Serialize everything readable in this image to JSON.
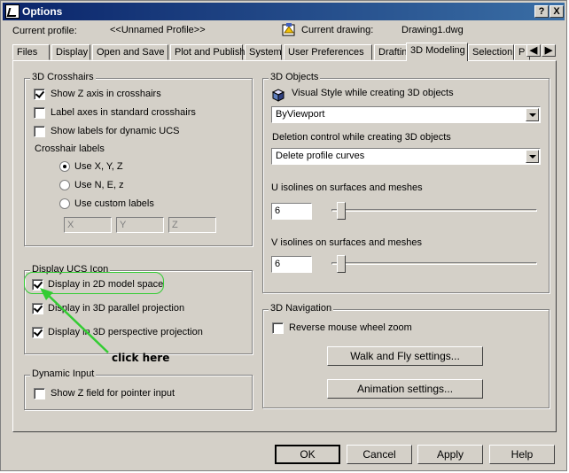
{
  "window": {
    "title": "Options"
  },
  "profile": {
    "label": "Current profile:",
    "value": "<<Unnamed Profile>>"
  },
  "drawing": {
    "label": "Current drawing:",
    "value": "Drawing1.dwg"
  },
  "tabs": [
    "Files",
    "Display",
    "Open and Save",
    "Plot and Publish",
    "System",
    "User Preferences",
    "Drafting",
    "3D Modeling",
    "Selection",
    "P"
  ],
  "active_tab": "3D Modeling",
  "crosshairs": {
    "title": "3D Crosshairs",
    "show_z_axis": "Show Z axis in crosshairs",
    "label_axes": "Label axes in standard crosshairs",
    "show_labels_ucs": "Show labels for dynamic UCS",
    "labels_title": "Crosshair labels",
    "opt_xyz": "Use X, Y, Z",
    "opt_nez": "Use N, E, z",
    "opt_custom": "Use custom labels",
    "custom_x": "X",
    "custom_y": "Y",
    "custom_z": "Z"
  },
  "ucs_icon": {
    "title": "Display UCS Icon",
    "model_space": "Display in 2D model space",
    "parallel": "Display in 3D parallel projection",
    "perspective": "Display in 3D perspective projection"
  },
  "dynamic_input": {
    "title": "Dynamic Input",
    "show_z": "Show Z field for pointer input"
  },
  "objects": {
    "title": "3D Objects",
    "visual_style_label": "Visual Style while creating 3D objects",
    "visual_style_value": "ByViewport",
    "deletion_label": "Deletion control while creating 3D objects",
    "deletion_value": "Delete profile curves",
    "u_label": "U isolines on surfaces and meshes",
    "u_value": "6",
    "v_label": "V isolines on surfaces and meshes",
    "v_value": "6"
  },
  "navigation": {
    "title": "3D Navigation",
    "reverse_zoom": "Reverse mouse wheel zoom",
    "walk_fly": "Walk and Fly settings...",
    "animation": "Animation settings..."
  },
  "buttons": {
    "ok": "OK",
    "cancel": "Cancel",
    "apply": "Apply",
    "help": "Help"
  },
  "annotation": {
    "text": "click here",
    "color": "#33cc33"
  },
  "icons": {
    "help": "?",
    "close": "X"
  }
}
